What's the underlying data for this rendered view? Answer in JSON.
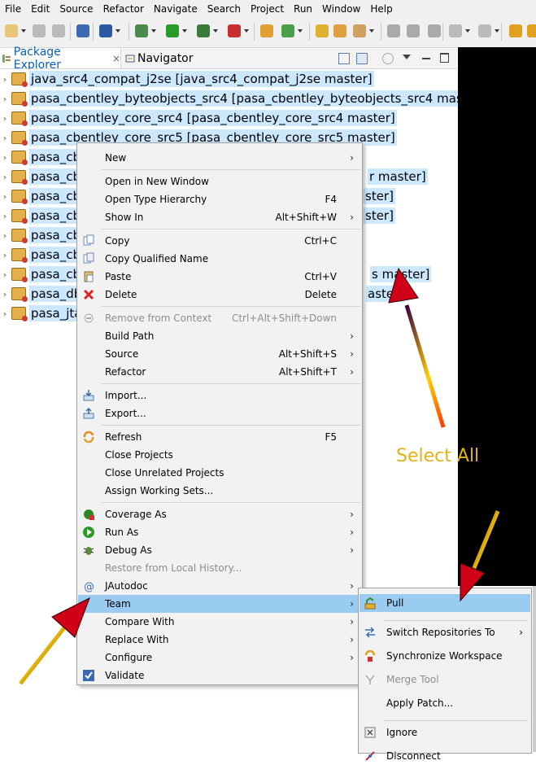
{
  "menubar": [
    "File",
    "Edit",
    "Source",
    "Refactor",
    "Navigate",
    "Search",
    "Project",
    "Run",
    "Window",
    "Help"
  ],
  "tabs": {
    "package_explorer": "Package Explorer",
    "close": "×",
    "navigator": "Navigator"
  },
  "projects": [
    "java_src4_compat_j2se [java_src4_compat_j2se master]",
    "pasa_cbentley_byteobjects_src4 [pasa_cbentley_byteobjects_src4 master]",
    "pasa_cbentley_core_src4 [pasa_cbentley_core_src4 master]",
    "pasa_cbentley_core_src5 [pasa_cbentley_core_src5 master]",
    "pasa_cbe",
    "pasa_cbe",
    "pasa_cbe",
    "pasa_cbe",
    "pasa_cbe",
    "pasa_cbe",
    "pasa_cbe",
    "pasa_db",
    "pasa_jta"
  ],
  "project_tails": [
    "",
    "",
    "",
    "",
    "",
    "r master]",
    "ster]",
    "ster]",
    "",
    "",
    "s master]",
    "aster]",
    ""
  ],
  "context_menu": [
    {
      "label": "New",
      "shortcut": "",
      "submenu": true,
      "icon": ""
    },
    {
      "sep": true
    },
    {
      "label": "Open in New Window",
      "shortcut": "",
      "icon": ""
    },
    {
      "label": "Open Type Hierarchy",
      "shortcut": "F4",
      "icon": ""
    },
    {
      "label": "Show In",
      "shortcut": "Alt+Shift+W",
      "submenu": true,
      "icon": ""
    },
    {
      "sep": true
    },
    {
      "label": "Copy",
      "shortcut": "Ctrl+C",
      "icon": "copy-icon"
    },
    {
      "label": "Copy Qualified Name",
      "shortcut": "",
      "icon": "copy-qualified-icon"
    },
    {
      "label": "Paste",
      "shortcut": "Ctrl+V",
      "icon": "paste-icon"
    },
    {
      "label": "Delete",
      "shortcut": "Delete",
      "icon": "delete-icon"
    },
    {
      "sep": true
    },
    {
      "label": "Remove from Context",
      "shortcut": "Ctrl+Alt+Shift+Down",
      "disabled": true,
      "icon": "remove-context-icon"
    },
    {
      "label": "Build Path",
      "shortcut": "",
      "submenu": true,
      "icon": ""
    },
    {
      "label": "Source",
      "shortcut": "Alt+Shift+S",
      "submenu": true,
      "icon": ""
    },
    {
      "label": "Refactor",
      "shortcut": "Alt+Shift+T",
      "submenu": true,
      "icon": ""
    },
    {
      "sep": true
    },
    {
      "label": "Import...",
      "shortcut": "",
      "icon": "import-icon"
    },
    {
      "label": "Export...",
      "shortcut": "",
      "icon": "export-icon"
    },
    {
      "sep": true
    },
    {
      "label": "Refresh",
      "shortcut": "F5",
      "icon": "refresh-icon"
    },
    {
      "label": "Close Projects",
      "shortcut": "",
      "icon": ""
    },
    {
      "label": "Close Unrelated Projects",
      "shortcut": "",
      "icon": ""
    },
    {
      "label": "Assign Working Sets...",
      "shortcut": "",
      "icon": ""
    },
    {
      "sep": true
    },
    {
      "label": "Coverage As",
      "shortcut": "",
      "submenu": true,
      "icon": "coverage-icon"
    },
    {
      "label": "Run As",
      "shortcut": "",
      "submenu": true,
      "icon": "run-icon"
    },
    {
      "label": "Debug As",
      "shortcut": "",
      "submenu": true,
      "icon": "debug-icon"
    },
    {
      "label": "Restore from Local History...",
      "shortcut": "",
      "disabled": true,
      "icon": ""
    },
    {
      "label": "JAutodoc",
      "shortcut": "",
      "submenu": true,
      "icon": "jautodoc-icon"
    },
    {
      "label": "Team",
      "shortcut": "",
      "submenu": true,
      "highlight": true,
      "icon": ""
    },
    {
      "label": "Compare With",
      "shortcut": "",
      "submenu": true,
      "icon": ""
    },
    {
      "label": "Replace With",
      "shortcut": "",
      "submenu": true,
      "icon": ""
    },
    {
      "label": "Configure",
      "shortcut": "",
      "submenu": true,
      "icon": ""
    },
    {
      "label": "Validate",
      "shortcut": "",
      "icon": "validate-check-icon"
    }
  ],
  "team_submenu": [
    {
      "label": "Pull",
      "highlight": true,
      "icon": "pull-icon"
    },
    {
      "sep": true
    },
    {
      "label": "Switch Repositories To",
      "submenu": true,
      "icon": "switch-repo-icon"
    },
    {
      "label": "Synchronize Workspace",
      "icon": "synchronize-icon"
    },
    {
      "label": "Merge Tool",
      "disabled": true,
      "icon": "merge-tool-icon"
    },
    {
      "label": "Apply Patch...",
      "icon": ""
    },
    {
      "sep": true
    },
    {
      "label": "Ignore",
      "icon": "ignore-icon"
    },
    {
      "label": "Disconnect",
      "icon": "disconnect-icon"
    }
  ],
  "annotation": {
    "text": "Select All",
    "color": "#e0b418"
  },
  "colors": {
    "selection": "#cce8ff",
    "menu_highlight": "#99ccf0",
    "menu_bg": "#f2f2f2"
  }
}
